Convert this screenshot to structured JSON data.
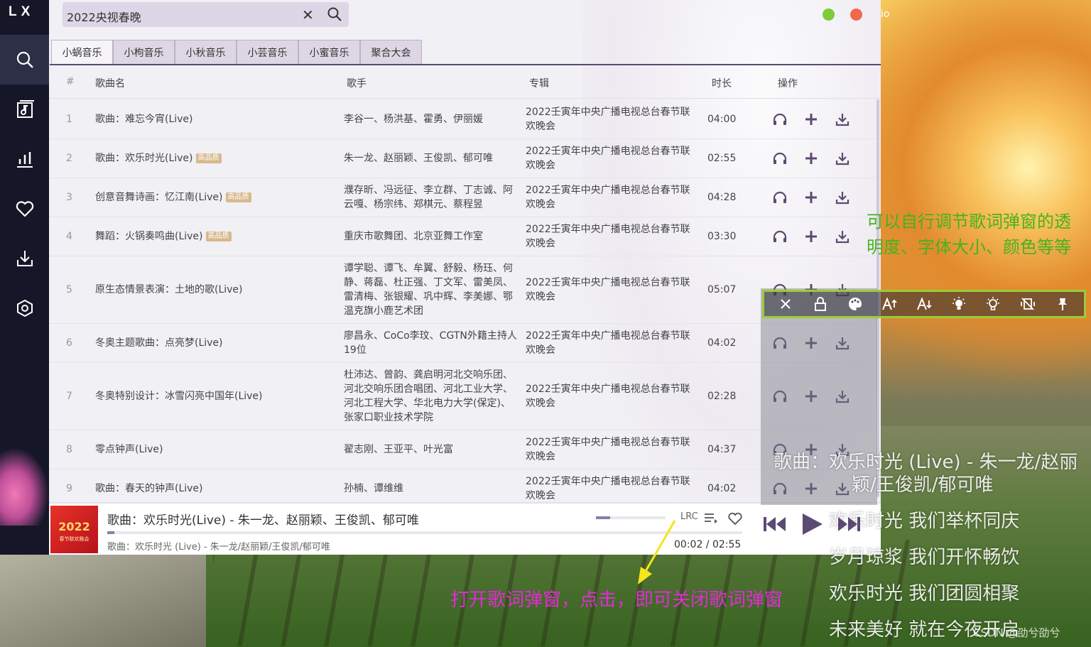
{
  "app": {
    "logo": "LX",
    "colors": {
      "sidebar": "#151729",
      "accent": "#5b4a72",
      "hq_badge": "#d7b98d"
    }
  },
  "desktop": {
    "ghost_text": "io",
    "watermark": "CSDN @劭兮劭兮"
  },
  "sidebar": {
    "items": [
      {
        "name": "search",
        "icon": "search-icon"
      },
      {
        "name": "song-list",
        "icon": "music-list-icon"
      },
      {
        "name": "leaderboard",
        "icon": "chart-icon"
      },
      {
        "name": "favorites",
        "icon": "heart-icon"
      },
      {
        "name": "download",
        "icon": "download-icon"
      },
      {
        "name": "settings",
        "icon": "settings-icon"
      }
    ]
  },
  "search": {
    "value": "2022央视春晚"
  },
  "tabs": [
    "小蜗音乐",
    "小枸音乐",
    "小秋音乐",
    "小芸音乐",
    "小蜜音乐",
    "聚合大会"
  ],
  "table": {
    "headers": {
      "num": "#",
      "name": "歌曲名",
      "artist": "歌手",
      "album": "专辑",
      "duration": "时长",
      "ops": "操作"
    },
    "rows": [
      {
        "num": "1",
        "name": "歌曲：难忘今宵(Live)",
        "hq": "",
        "artist": "李谷一、杨洪基、霍勇、伊丽媛",
        "album": "2022壬寅年中央广播电视总台春节联欢晚会",
        "duration": "04:00"
      },
      {
        "num": "2",
        "name": "歌曲：欢乐时光(Live)",
        "hq": "高品质",
        "artist": "朱一龙、赵丽颖、王俊凯、郁可唯",
        "album": "2022壬寅年中央广播电视总台春节联欢晚会",
        "duration": "02:55"
      },
      {
        "num": "3",
        "name": "创意音舞诗画：忆江南(Live)",
        "hq": "高品质",
        "artist": "濮存昕、冯远征、李立群、丁志诚、阿云嘎、杨宗纬、郑棋元、蔡程昱",
        "album": "2022壬寅年中央广播电视总台春节联欢晚会",
        "duration": "04:28"
      },
      {
        "num": "4",
        "name": "舞蹈：火锅奏鸣曲(Live)",
        "hq": "高品质",
        "artist": "重庆市歌舞团、北京亚舞工作室",
        "album": "2022壬寅年中央广播电视总台春节联欢晚会",
        "duration": "03:30"
      },
      {
        "num": "5",
        "name": "原生态情景表演：土地的歌(Live)",
        "hq": "",
        "artist": "谭学聪、谭飞、牟翼、舒毅、杨珏、何静、蒋磊、杜正强、丁文军、雷美凤、雷清梅、张银耀、巩中辉、李美娜、鄂温克旗小鹿艺术团",
        "album": "2022壬寅年中央广播电视总台春节联欢晚会",
        "duration": "05:07"
      },
      {
        "num": "6",
        "name": "冬奥主题歌曲：点亮梦(Live)",
        "hq": "",
        "artist": "廖昌永、CoCo李玟、CGTN外籍主持人19位",
        "album": "2022壬寅年中央广播电视总台春节联欢晚会",
        "duration": "04:02"
      },
      {
        "num": "7",
        "name": "冬奥特别设计：冰雪闪亮中国年(Live)",
        "hq": "",
        "artist": "杜沛达、曾韵、龚启明河北交响乐团、河北交响乐团合唱团、河北工业大学、河北工程大学、华北电力大学(保定)、张家口职业技术学院",
        "album": "2022壬寅年中央广播电视总台春节联欢晚会",
        "duration": "02:28"
      },
      {
        "num": "8",
        "name": "零点钟声(Live)",
        "hq": "",
        "artist": "翟志刚、王亚平、叶光富",
        "album": "2022壬寅年中央广播电视总台春节联欢晚会",
        "duration": "04:37"
      },
      {
        "num": "9",
        "name": "歌曲：春天的钟声(Live)",
        "hq": "",
        "artist": "孙楠、谭维维",
        "album": "2022壬寅年中央广播电视总台春节联欢晚会",
        "duration": "04:02"
      }
    ]
  },
  "player": {
    "cover_year": "2022",
    "cover_sub": "春节联欢晚会",
    "title": "歌曲：欢乐时光(Live) - 朱一龙、赵丽颖、王俊凯、郁可唯",
    "lyric": "歌曲：欢乐时光 (Live) - 朱一龙/赵丽颖/王俊凯/郁可唯",
    "lrc_label": "LRC",
    "time": "00:02 / 02:55",
    "progress": 0.011,
    "volume": 0.2
  },
  "lyric_popup": {
    "line1a": "歌曲：欢乐时光 (Live) - 朱一龙/赵丽",
    "line1b": "颖/王俊凯/郁可唯",
    "lines": [
      "欢乐时光 我们举杯同庆",
      "岁月琼浆 我们开怀畅饮",
      "欢乐时光 我们团圆相聚",
      "未来美好 就在今夜开启"
    ]
  },
  "annotations": {
    "green_note": "可以自行调节歌词弹窗的透明度、字体大小、颜色等等",
    "magenta_note": "打开歌词弹窗，点击，即可关闭歌词弹窗"
  }
}
